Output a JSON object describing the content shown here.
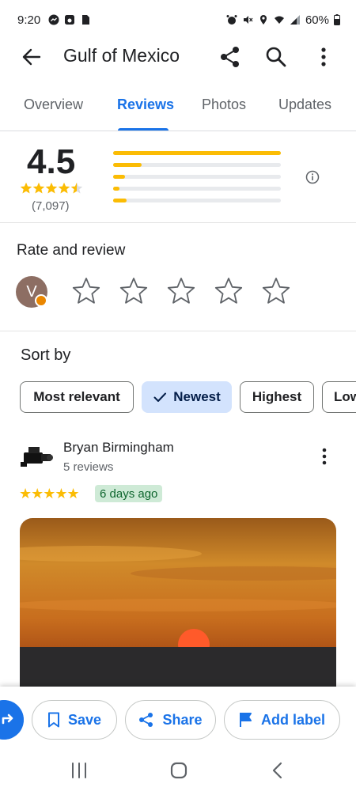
{
  "status_bar": {
    "time": "9:20",
    "battery": "60%",
    "left_icons": [
      "messenger-icon",
      "square-app-icon",
      "sim-card-icon"
    ],
    "right_icons": [
      "alarm-icon",
      "mute-icon",
      "location-icon",
      "wifi-icon",
      "signal-icon",
      "battery-icon"
    ]
  },
  "app_bar": {
    "title": "Gulf of Mexico"
  },
  "tabs": [
    {
      "label": "Overview",
      "active": false
    },
    {
      "label": "Reviews",
      "active": true
    },
    {
      "label": "Photos",
      "active": false
    },
    {
      "label": "Updates",
      "active": false
    }
  ],
  "summary": {
    "rating": "4.5",
    "stars": 4.5,
    "count": "(7,097)",
    "distribution": [
      {
        "stars": 5,
        "fraction": 1.0
      },
      {
        "stars": 4,
        "fraction": 0.17
      },
      {
        "stars": 3,
        "fraction": 0.07
      },
      {
        "stars": 2,
        "fraction": 0.04
      },
      {
        "stars": 1,
        "fraction": 0.08
      }
    ]
  },
  "rate_review": {
    "title": "Rate and review",
    "avatar_letter": "V",
    "star_count": 5
  },
  "sort": {
    "title": "Sort by",
    "options": [
      {
        "label": "Most relevant",
        "selected": false
      },
      {
        "label": "Newest",
        "selected": true
      },
      {
        "label": "Highest",
        "selected": false
      },
      {
        "label": "Lowest",
        "selected": false
      }
    ]
  },
  "review": {
    "name": "Bryan Birmingham",
    "meta": "5 reviews",
    "stars": "★★★★★",
    "time": "6 days ago"
  },
  "actions": {
    "save": "Save",
    "share": "Share",
    "add_label": "Add label"
  },
  "colors": {
    "accent": "#1a73e8",
    "star": "#fbbc04",
    "chip_selected": "#d3e3fd",
    "time_badge": "#ceead6"
  }
}
